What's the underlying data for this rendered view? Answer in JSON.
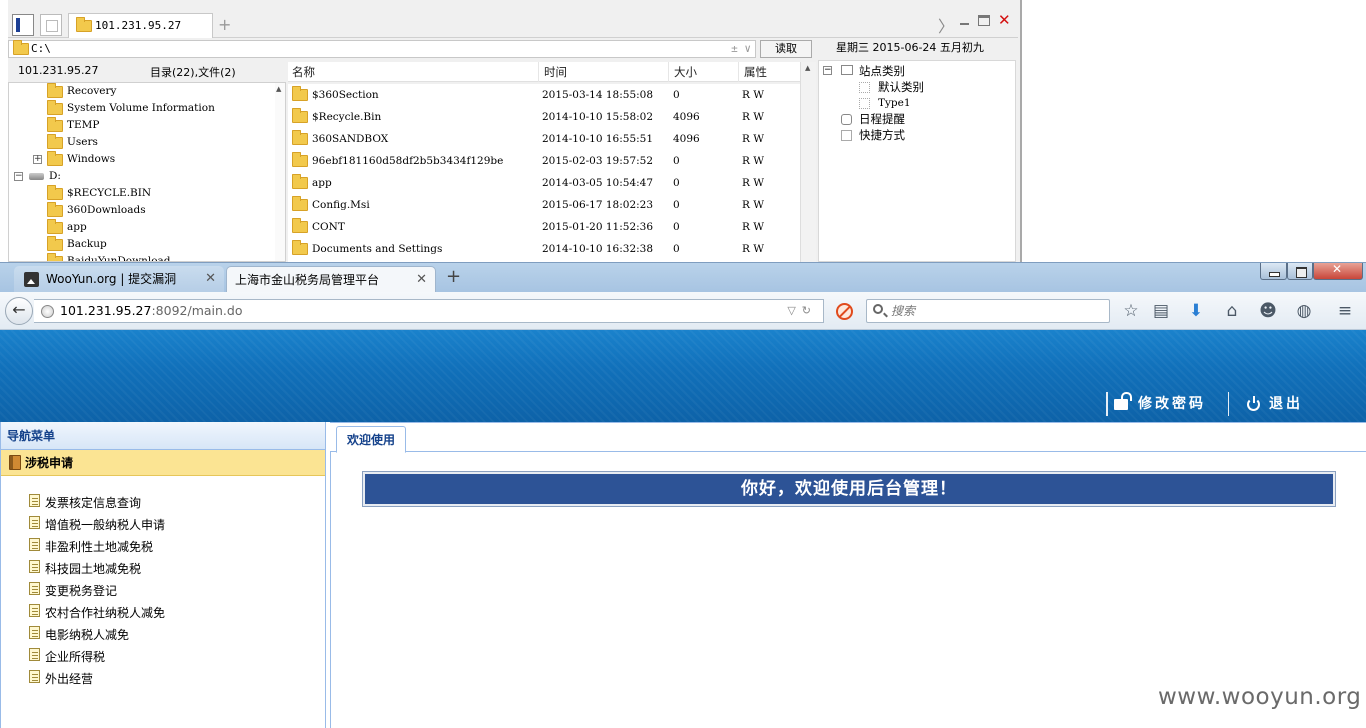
{
  "file_manager": {
    "active_tab": "101.231.95.27",
    "path": "C:\\",
    "path_controls": "± ∨",
    "read_button": "读取",
    "date_line": "星期三 2015-06-24 五月初九",
    "host": "101.231.95.27",
    "summary": "目录(22),文件(2)",
    "tree": [
      {
        "label": "Recovery",
        "type": "folder"
      },
      {
        "label": "System Volume Information",
        "type": "folder"
      },
      {
        "label": "TEMP",
        "type": "folder"
      },
      {
        "label": "Users",
        "type": "folder"
      },
      {
        "label": "Windows",
        "type": "folder",
        "expander": "+"
      },
      {
        "label": "D:",
        "type": "drive",
        "expander": "−"
      },
      {
        "label": "$RECYCLE.BIN",
        "type": "folder"
      },
      {
        "label": "360Downloads",
        "type": "folder"
      },
      {
        "label": "app",
        "type": "folder"
      },
      {
        "label": "Backup",
        "type": "folder"
      },
      {
        "label": "BaiduYunDownload",
        "type": "folder"
      }
    ],
    "columns": {
      "name": "名称",
      "time": "时间",
      "size": "大小",
      "attr": "属性"
    },
    "files": [
      {
        "name": "$360Section",
        "time": "2015-03-14 18:55:08",
        "size": "0",
        "attr": "R W"
      },
      {
        "name": "$Recycle.Bin",
        "time": "2014-10-10 15:58:02",
        "size": "4096",
        "attr": "R W"
      },
      {
        "name": "360SANDBOX",
        "time": "2014-10-10 16:55:51",
        "size": "4096",
        "attr": "R W"
      },
      {
        "name": "96ebf181160d58df2b5b3434f129be",
        "time": "2015-02-03 19:57:52",
        "size": "0",
        "attr": "R W"
      },
      {
        "name": "app",
        "time": "2014-03-05 10:54:47",
        "size": "0",
        "attr": "R W"
      },
      {
        "name": "Config.Msi",
        "time": "2015-06-17 18:02:23",
        "size": "0",
        "attr": "R W"
      },
      {
        "name": "CONT",
        "time": "2015-01-20 11:52:36",
        "size": "0",
        "attr": "R W"
      },
      {
        "name": "Documents and Settings",
        "time": "2014-10-10 16:32:38",
        "size": "0",
        "attr": "R W"
      }
    ],
    "side_tree": {
      "site_category": "站点类别",
      "default_category": "默认类别",
      "type1": "Type1",
      "schedule": "日程提醒",
      "shortcuts": "快捷方式"
    }
  },
  "browser": {
    "tabs": [
      {
        "label": "WooYun.org | 提交漏洞"
      },
      {
        "label": "上海市金山税务局管理平台"
      }
    ],
    "url_host": "101.231.95.27",
    "url_rest": ":8092/main.do",
    "search_placeholder": "搜索",
    "toolbar_icons": [
      "star-icon",
      "reading-list-icon",
      "download-icon",
      "home-icon",
      "smiley-icon",
      "globe-icon",
      "menu-icon"
    ]
  },
  "page": {
    "header": {
      "change_password": "修改密码",
      "logout": "退出"
    },
    "nav": {
      "title": "导航菜单",
      "group": "涉税申请",
      "items": [
        "发票核定信息查询",
        "增值税一般纳税人申请",
        "非盈利性土地减免税",
        "科技园土地减免税",
        "变更税务登记",
        "农村合作社纳税人减免",
        "电影纳税人减免",
        "企业所得税",
        "外出经营"
      ]
    },
    "tab": "欢迎使用",
    "welcome": "你好，欢迎使用后台管理！"
  },
  "watermark": "www.wooyun.org",
  "colors": {
    "header_blue": "#1171bb",
    "banner_blue": "#2d5396",
    "nav_group_yellow": "#fbe493",
    "panel_border": "#99bbe8"
  }
}
